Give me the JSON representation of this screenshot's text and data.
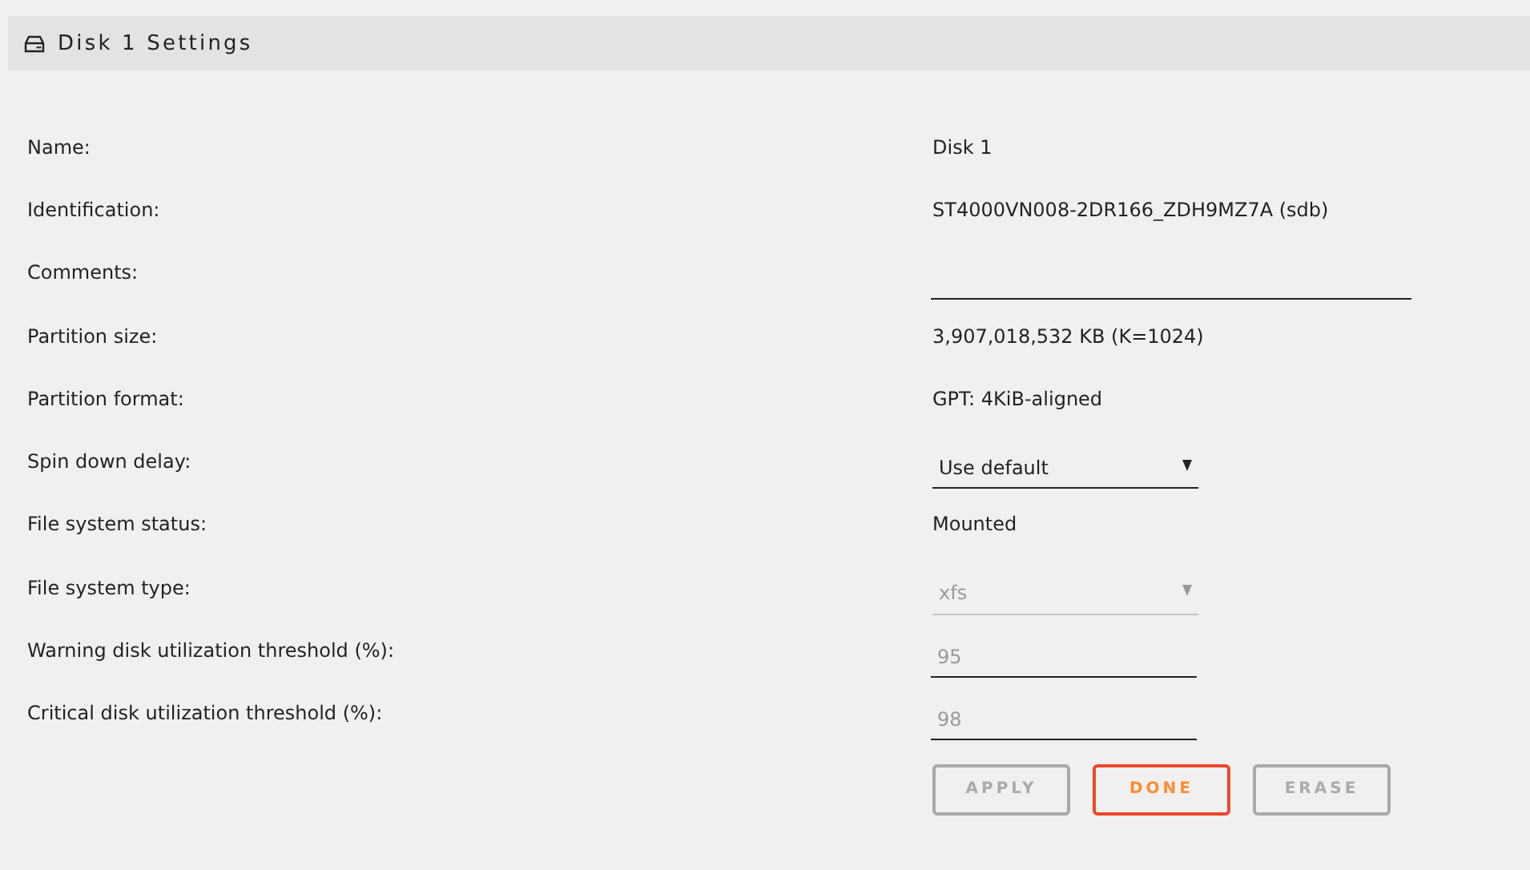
{
  "header": {
    "title": "Disk 1 Settings"
  },
  "rows": [
    {
      "label": "Name:",
      "kind": "text",
      "value": "Disk 1"
    },
    {
      "label": "Identification:",
      "kind": "text",
      "value": "ST4000VN008-2DR166_ZDH9MZ7A (sdb)"
    },
    {
      "label": "Comments:",
      "kind": "input",
      "wide": true
    },
    {
      "label": "Partition size:",
      "kind": "text",
      "value": "3,907,018,532 KB (K=1024)"
    },
    {
      "label": "Partition format:",
      "kind": "text",
      "value": "GPT: 4KiB-aligned"
    },
    {
      "label": "Spin down delay:",
      "kind": "select",
      "value": "Use default",
      "disabled": false
    },
    {
      "label": "File system status:",
      "kind": "text",
      "value": "Mounted"
    },
    {
      "label": "File system type:",
      "kind": "select",
      "value": "xfs",
      "disabled": true
    },
    {
      "label": "Warning disk utilization threshold (%):",
      "kind": "input",
      "placeholder": "95"
    },
    {
      "label": "Critical disk utilization threshold (%):",
      "kind": "input",
      "placeholder": "98"
    }
  ],
  "buttons": [
    {
      "label": "APPLY",
      "disabled": true
    },
    {
      "label": "DONE",
      "disabled": false
    },
    {
      "label": "ERASE",
      "disabled": true
    }
  ]
}
